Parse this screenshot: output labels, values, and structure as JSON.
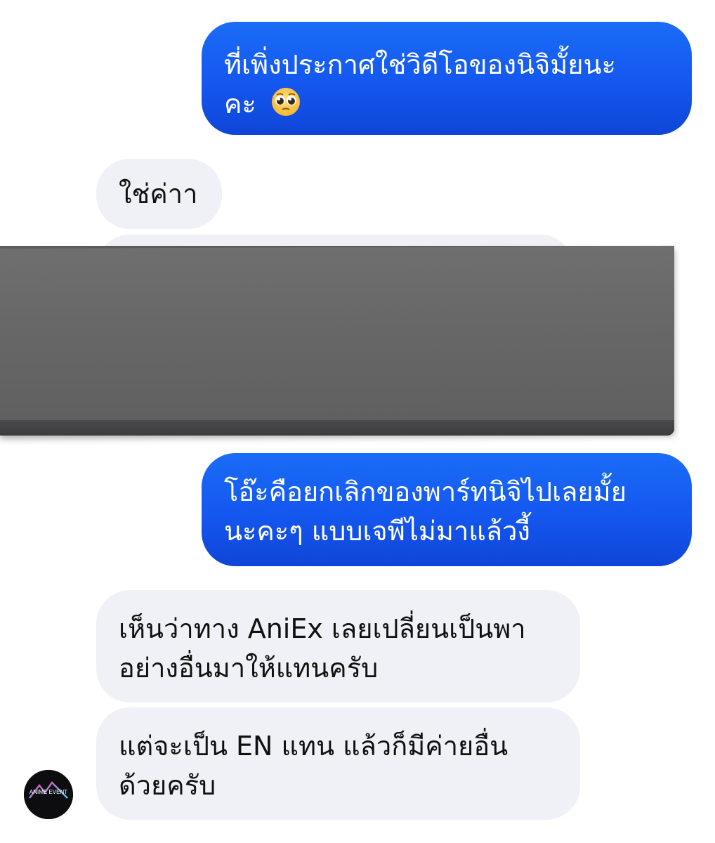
{
  "messages": [
    {
      "id": "out-1",
      "direction": "outgoing",
      "lines": [
        "ที่เพิ่งประกาศใช่วิดีโอของนิจิมั้ยนะ",
        "คะ"
      ],
      "emoji": "pleading-face-emoji"
    },
    {
      "id": "in-1",
      "direction": "incoming",
      "lines": [
        "ใช่ค่าา"
      ]
    },
    {
      "id": "out-2",
      "direction": "outgoing",
      "lines": [
        "โอ๊ะคือยกเลิกของพาร์ทนิจิไปเลยมั้ย",
        "นะคะๆ แบบเจพีไม่มาแล้วงี้"
      ]
    },
    {
      "id": "in-2",
      "direction": "incoming",
      "lines": [
        "เห็นว่าทาง AniEx เลยเปลี่ยนเป็นพา",
        "อย่างอื่นมาให้แทนครับ"
      ]
    },
    {
      "id": "in-3",
      "direction": "incoming",
      "lines": [
        "แต่จะเป็น EN แทน แล้วก็มีค่ายอื่น",
        "ด้วยครับ"
      ]
    }
  ],
  "redaction": {
    "color": "#676768"
  },
  "avatar": {
    "icon": "anime-event-logo-avatar",
    "text": "ANIME EVENT"
  },
  "colors": {
    "outgoing_bubble": "#1457ef",
    "incoming_bubble": "#f0f1f6",
    "outgoing_text": "#ffffff",
    "incoming_text": "#111111"
  }
}
